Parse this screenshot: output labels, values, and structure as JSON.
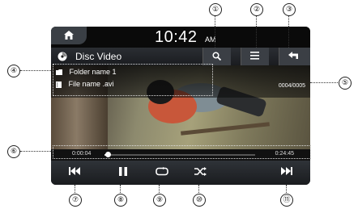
{
  "status": {
    "time": "10:42",
    "ampm": "AM"
  },
  "header": {
    "title": "Disc Video"
  },
  "info": {
    "folder": "Folder name 1",
    "file": "File name .avi",
    "counter": "0004/0005"
  },
  "playback": {
    "elapsed": "0:00:04",
    "total": "0:24:45",
    "progress_fraction": 0.02
  },
  "callouts": [
    "①",
    "②",
    "③",
    "④",
    "⑤",
    "⑥",
    "⑦",
    "⑧",
    "⑨",
    "⑩",
    "⑪"
  ],
  "icons": {
    "home": "home-icon",
    "disc": "disc-icon",
    "search": "search-icon",
    "menu": "menu-icon",
    "back": "back-icon",
    "folder": "folder-icon",
    "file": "file-icon",
    "prev": "skip-previous-icon",
    "pause": "pause-icon",
    "repeat": "repeat-icon",
    "shuffle": "shuffle-icon",
    "next": "skip-next-icon"
  },
  "colors": {
    "screen_bg": "#0d0d0d",
    "button_bg": "#3b3f45",
    "text": "#ffffff"
  }
}
